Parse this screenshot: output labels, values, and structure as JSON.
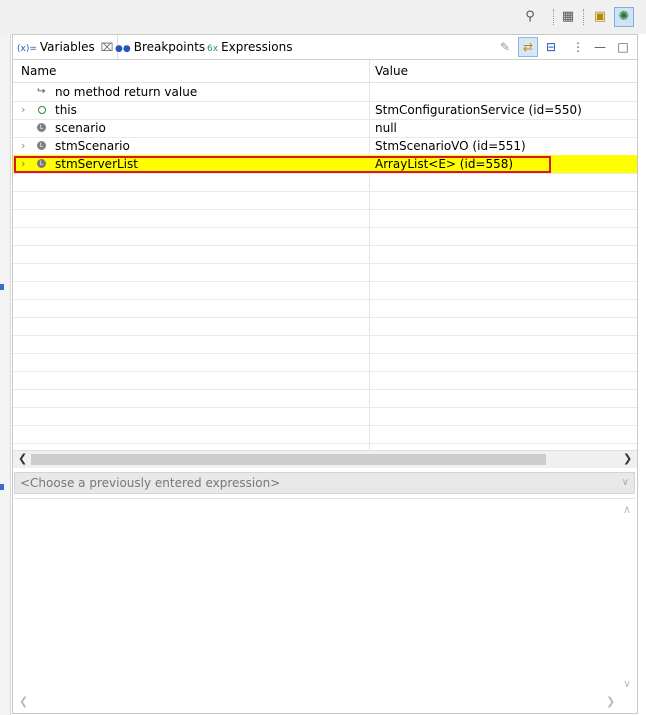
{
  "toolbar": {
    "icons": [
      "search-icon",
      "open-perspective-icon",
      "java-perspective-icon",
      "debug-perspective-icon"
    ]
  },
  "tabs": [
    {
      "id": "variables",
      "icon_text": "(x)=",
      "label": "Variables",
      "active": true
    },
    {
      "id": "breakpoints",
      "icon_text": "●●",
      "label": "Breakpoints",
      "active": false
    },
    {
      "id": "expressions",
      "icon_text": "6x",
      "label": "Expressions",
      "active": false
    }
  ],
  "table": {
    "columns": [
      "Name",
      "Value"
    ],
    "rows": [
      {
        "name": "no method return value",
        "value": "",
        "expandable": false,
        "icon": "return-icon"
      },
      {
        "name": "this",
        "value": "StmConfigurationService  (id=550)",
        "expandable": true,
        "icon": "field-icon"
      },
      {
        "name": "scenario",
        "value": "null",
        "expandable": false,
        "icon": "local-variable-icon"
      },
      {
        "name": "stmScenario",
        "value": "StmScenarioVO  (id=551)",
        "expandable": true,
        "icon": "local-variable-icon"
      },
      {
        "name": "stmServerList",
        "value": "ArrayList<E>  (id=558)",
        "expandable": true,
        "icon": "local-variable-icon",
        "selected": true
      }
    ]
  },
  "expression": {
    "placeholder": "<Choose a previously entered expression>"
  },
  "colors": {
    "selection": "#ffff00",
    "highlight_border": "#e0141e"
  }
}
